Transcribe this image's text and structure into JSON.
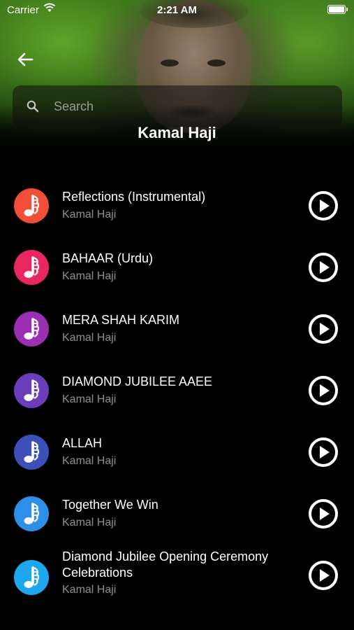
{
  "status_bar": {
    "carrier": "Carrier",
    "time": "2:21 AM"
  },
  "header": {
    "back_icon": "arrow-left-icon",
    "artist_name": "Kamal Haji"
  },
  "search": {
    "placeholder": "Search",
    "icon": "search-icon"
  },
  "songs": [
    {
      "title": "Reflections (Instrumental)",
      "artist": "Kamal Haji",
      "color": "#f04e37"
    },
    {
      "title": "BAHAAR (Urdu)",
      "artist": "Kamal Haji",
      "color": "#e8265f"
    },
    {
      "title": "MERA SHAH KARIM",
      "artist": "Kamal Haji",
      "color": "#9a2fb4"
    },
    {
      "title": "DIAMOND JUBILEE AAEE",
      "artist": "Kamal Haji",
      "color": "#6a3dbb"
    },
    {
      "title": "ALLAH",
      "artist": "Kamal Haji",
      "color": "#3d4fb8"
    },
    {
      "title": "Together We Win",
      "artist": "Kamal Haji",
      "color": "#2d8fe8"
    },
    {
      "title": "Diamond Jubilee Opening Ceremony Celebrations",
      "artist": "Kamal Haji",
      "color": "#1ea7ee"
    }
  ],
  "icons": {
    "song": "music-note-icon",
    "play": "play-circle-icon"
  }
}
